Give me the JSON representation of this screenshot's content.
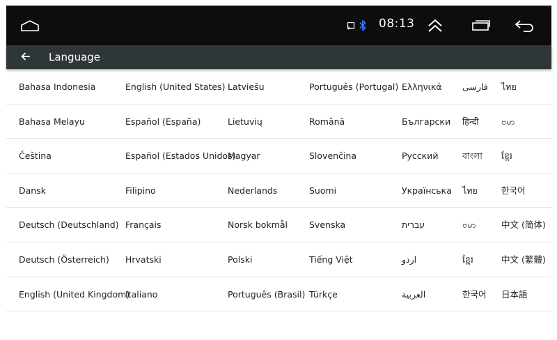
{
  "status_bar": {
    "time": "08:13",
    "icons": [
      "home-icon",
      "cast-icon",
      "bluetooth-icon",
      "expand-up-icon",
      "recents-icon",
      "back-icon"
    ]
  },
  "app_bar": {
    "title": "Language",
    "back_icon": "arrow-left-icon"
  },
  "languages": [
    [
      "Bahasa Indonesia",
      "English (United States)",
      "Latviešu",
      "Português (Portugal)",
      "Ελληνικά",
      "فارسی",
      "ไทย"
    ],
    [
      "Bahasa Melayu",
      "Español (España)",
      "Lietuvių",
      "Română",
      "Български",
      "हिन्दी",
      "ဗမာ"
    ],
    [
      "Čeština",
      "Español (Estados Unidos)",
      "Magyar",
      "Slovenčina",
      "Русский",
      "বাংলা",
      "ខ្មែរ"
    ],
    [
      "Dansk",
      "Filipino",
      "Nederlands",
      "Suomi",
      "Українська",
      "ไทย",
      "한국어"
    ],
    [
      "Deutsch (Deutschland)",
      "Français",
      "Norsk bokmål",
      "Svenska",
      "עברית",
      "ဗမာ",
      "中文 (简体)"
    ],
    [
      "Deutsch (Österreich)",
      "Hrvatski",
      "Polski",
      "Tiếng Việt",
      "اردو",
      "ខ្មែរ",
      "中文 (繁體)"
    ],
    [
      "English (United Kingdom)",
      "Italiano",
      "Português (Brasil)",
      "Türkçe",
      "العربية",
      "한국어",
      "日本語"
    ]
  ],
  "colors": {
    "status_bar": "#0d0d0d",
    "app_bar": "#2f3638",
    "bluetooth": "#3a7bff",
    "divider": "#e2e2e2"
  }
}
